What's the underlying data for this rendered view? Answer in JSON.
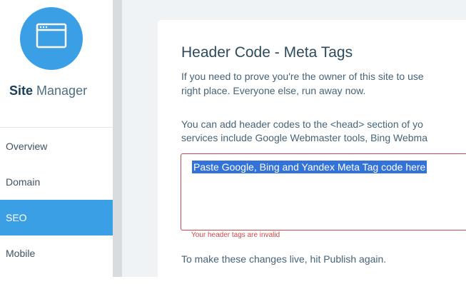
{
  "sidebar": {
    "brand_strong": "Site",
    "brand_light": "Manager",
    "items": [
      {
        "label": "Overview"
      },
      {
        "label": "Domain"
      },
      {
        "label": "SEO"
      },
      {
        "label": "Mobile"
      }
    ],
    "active_item": "SEO",
    "logo_icon": "browser-window-icon"
  },
  "card": {
    "title": "Header Code - Meta Tags",
    "intro_line1": "If you need to prove you're the owner of this site to use",
    "intro_line2": "right place. Everyone else, run away now.",
    "desc_line1": "You can add header codes to the <head> section of yo",
    "desc_line2": "services include Google Webmaster tools, Bing Webma",
    "textarea_value": "Paste Google, Bing and Yandex Meta Tag code here",
    "error": "Your header tags are invalid",
    "publish_note": "To make these changes live, hit Publish again."
  },
  "colors": {
    "accent": "#3b9fe6",
    "error": "#d04848",
    "selection": "#3373d8"
  }
}
